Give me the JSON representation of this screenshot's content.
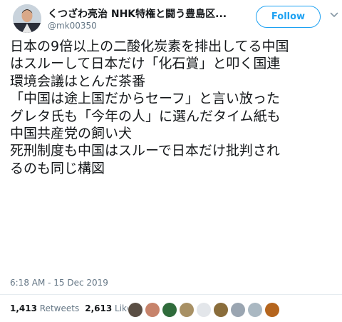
{
  "user": {
    "display_name": "くつざわ亮治 NHK特権と闘う豊島区...",
    "handle": "@mk00350"
  },
  "follow_label": "Follow",
  "tweet_lines": [
    "日本の9倍以上の二酸化炭素を排出してる中国",
    "はスルーして日本だけ「化石賞」と叩く国連",
    "環境会議はとんだ茶番",
    "「中国は途上国だからセーフ」と言い放った",
    "グレタ氏も「今年の人」に選んだタイム紙も",
    "中国共産党の飼い犬",
    "死刑制度も中国はスルーで日本だけ批判され",
    "るのも同じ構図"
  ],
  "timestamp": "6:18 AM - 15 Dec 2019",
  "stats": {
    "retweets_count": "1,413",
    "retweets_label": "Retweets",
    "likes_count": "2,613",
    "likes_label": "Likes"
  },
  "colors": {
    "accent": "#1da1f2",
    "text_primary": "#14171a",
    "text_secondary": "#657786",
    "divider": "#e6ecf0"
  },
  "liker_avatars": [
    {
      "icon": "liker-avatar-icon",
      "color": "#5a4e44"
    },
    {
      "icon": "liker-avatar-icon",
      "color": "#c7836b"
    },
    {
      "icon": "liker-avatar-icon",
      "color": "#2f6b3b"
    },
    {
      "icon": "liker-avatar-icon",
      "color": "#a89064"
    },
    {
      "icon": "liker-avatar-icon",
      "color": "#e3e6ea"
    },
    {
      "icon": "liker-avatar-icon",
      "color": "#8a6d3b"
    },
    {
      "icon": "liker-avatar-icon",
      "color": "#9aa5b1"
    },
    {
      "icon": "liker-avatar-icon",
      "color": "#aab8c2"
    },
    {
      "icon": "liker-avatar-icon",
      "color": "#b5651d"
    }
  ]
}
